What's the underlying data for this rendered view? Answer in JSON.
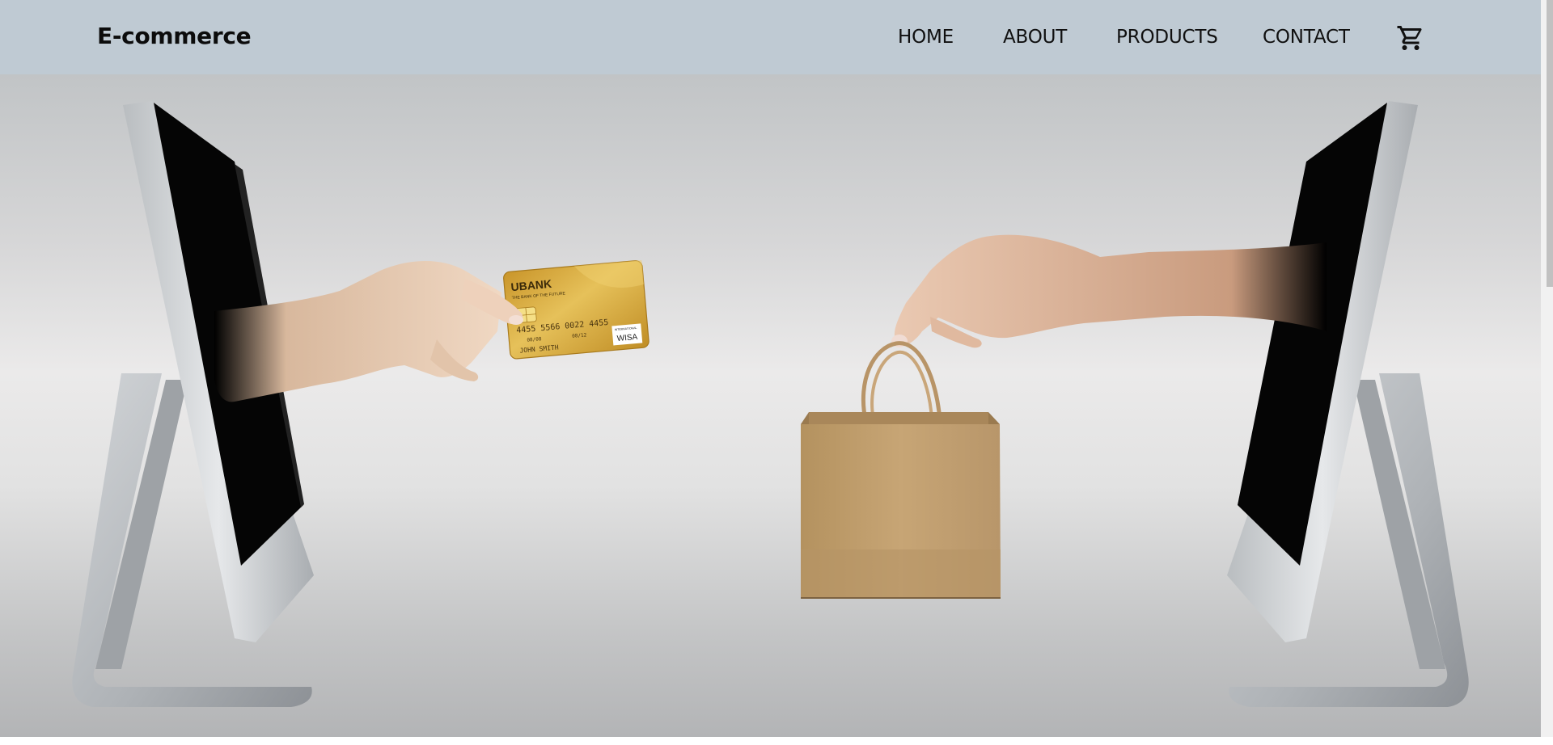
{
  "brand": {
    "name": "E-commerce"
  },
  "nav": {
    "items": [
      {
        "label": "HOME"
      },
      {
        "label": "ABOUT"
      },
      {
        "label": "PRODUCTS"
      },
      {
        "label": "CONTACT"
      }
    ],
    "cart_icon": "shopping-cart-icon"
  },
  "hero": {
    "card": {
      "bank": "UBANK",
      "tagline": "THE BANK OF THE FUTURE",
      "number": "4455  5566  0022  4455",
      "valid_from": "08/08",
      "expires": "08/12",
      "holder": "JOHN SMITH",
      "network_caption": "INTERNATIONAL",
      "network": "WISA"
    }
  },
  "colors": {
    "navbar_bg": "#bfcad3",
    "text": "#101010",
    "hero_bg": "#e6e6e6",
    "screen": "#050505",
    "card_gold": "#d9a93a",
    "bag_kraft": "#c4a172"
  }
}
